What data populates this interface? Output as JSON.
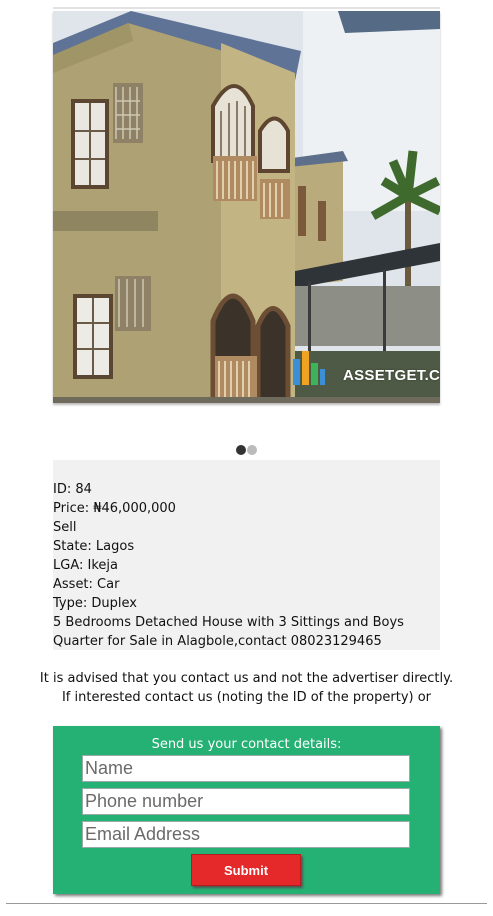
{
  "listing": {
    "watermark": "ASSETGET.COM",
    "carousel": {
      "total_slides": 2,
      "active_slide": 1
    },
    "id_line": "ID: 84",
    "price_line": "Price: ₦46,000,000",
    "deal_type": "Sell",
    "state_line": "State: Lagos",
    "lga_line": "LGA: Ikeja",
    "asset_line": "Asset: Car",
    "type_line": "Type: Duplex",
    "description": "5 Bedrooms Detached House with 3 Sittings and Boys Quarter for Sale in Alagbole,contact 08023129465"
  },
  "advice": {
    "line1": "It is advised that you contact us and not the advertiser directly.",
    "line2": "If interested contact us (noting the ID of the property) or"
  },
  "contact_form": {
    "title": "Send us your contact details:",
    "name_placeholder": "Name",
    "phone_placeholder": "Phone number",
    "email_placeholder": "Email Address",
    "submit_label": "Submit"
  },
  "colors": {
    "form_background": "#25b174",
    "submit_background": "#e5282a",
    "info_background": "#f1f1f1"
  }
}
